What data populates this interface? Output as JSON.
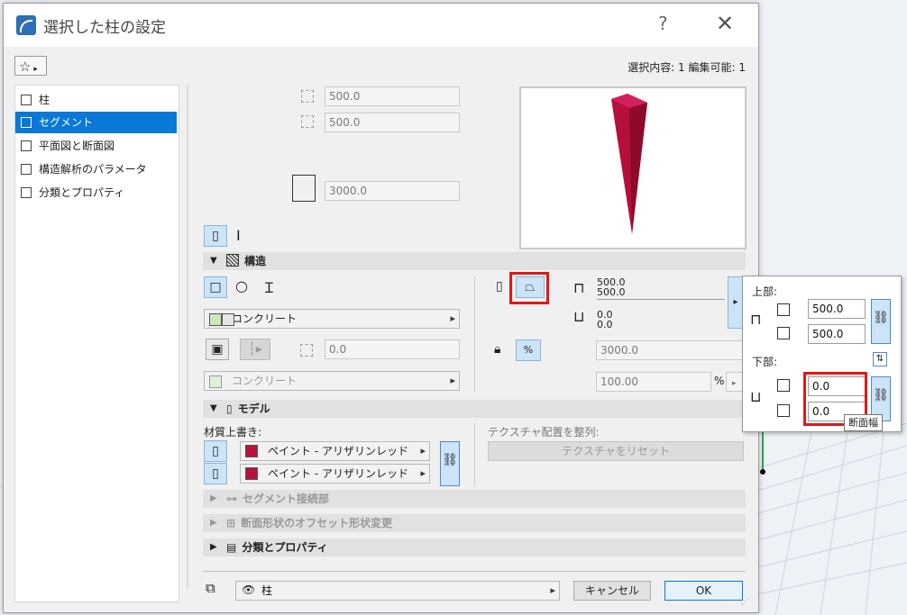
{
  "window": {
    "title": "選択した柱の設定",
    "help": "?",
    "close": "✕"
  },
  "selection_info": "選択内容: 1 編集可能: 1",
  "nav": {
    "items": [
      {
        "label": "柱",
        "active": false
      },
      {
        "label": "セグメント",
        "active": true
      },
      {
        "label": "平面図と断面図",
        "active": false
      },
      {
        "label": "構造解析のパラメータ",
        "active": false
      },
      {
        "label": "分類とプロパティ",
        "active": false
      }
    ]
  },
  "geometry": {
    "width": "500.0",
    "depth": "500.0",
    "height": "3000.0"
  },
  "sections": {
    "structure": "構造",
    "model": "モデル",
    "segment_connect": "セグメント接続部",
    "profile_offset": "断面形状のオフセット形状変更",
    "classification": "分類とプロパティ"
  },
  "structure": {
    "material": "コンクリート",
    "core_value": "0.0",
    "material2": "コンクリート",
    "top_vals": [
      "500.0",
      "500.0"
    ],
    "bottom_vals": [
      "0.0",
      "0.0"
    ],
    "length": "3000.0",
    "percent": "100.00",
    "percent_unit": "%"
  },
  "model": {
    "override_label": "材質上書き:",
    "paint1": "ペイント - アリザリンレッド",
    "paint2": "ペイント - アリザリンレッド",
    "texture_label": "テクスチャ配置を整列:",
    "texture_reset": "テクスチャをリセット"
  },
  "footer": {
    "layer": "柱",
    "cancel": "キャンセル",
    "ok": "OK"
  },
  "popup": {
    "top_label": "上部:",
    "top_width": "500.0",
    "top_depth": "500.0",
    "bottom_label": "下部:",
    "bottom_width": "0.0",
    "bottom_depth": "0.0",
    "tooltip": "断面幅"
  },
  "colors": {
    "accent": "#0a78d7",
    "paint": "#b8123b",
    "highlight": "#e01818"
  }
}
